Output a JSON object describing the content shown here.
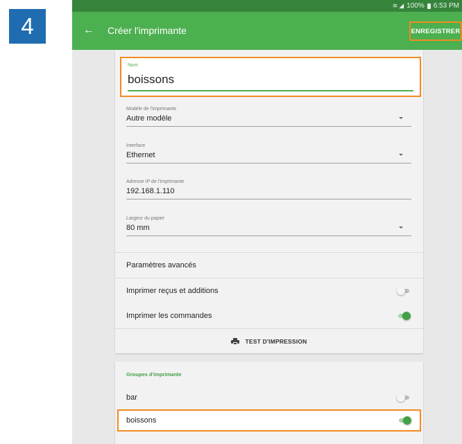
{
  "step_number": "4",
  "status_bar": {
    "battery_text": "100%",
    "time": "6:53 PM"
  },
  "app_bar": {
    "title": "Créer l'imprimante",
    "save_label": "ENREGISTRER"
  },
  "printer_form": {
    "name": {
      "label": "Nom",
      "value": "boissons"
    },
    "model": {
      "label": "Modèle de l'imprimante",
      "value": "Autre modèle"
    },
    "interface": {
      "label": "Interface",
      "value": "Ethernet"
    },
    "ip_address": {
      "label": "Adresse IP de l'imprimante",
      "value": "192.168.1.110"
    },
    "paper_width": {
      "label": "Largeur du papier",
      "value": "80 mm"
    },
    "advanced_settings_label": "Paramètres avancés",
    "print_receipts": {
      "label": "Imprimer reçus et additions",
      "enabled": false
    },
    "print_orders": {
      "label": "Imprimer les commandes",
      "enabled": true
    },
    "test_print_label": "TEST D'IMPRESSION"
  },
  "printer_groups": {
    "title": "Groupes d'imprimante",
    "items": [
      {
        "label": "bar",
        "enabled": false
      },
      {
        "label": "boissons",
        "enabled": true
      }
    ]
  },
  "colors": {
    "app_bar": "#4caf50",
    "status_bar": "#36843c",
    "accent": "#43a047",
    "highlight": "#f28a21",
    "step_badge": "#1f6db0"
  }
}
